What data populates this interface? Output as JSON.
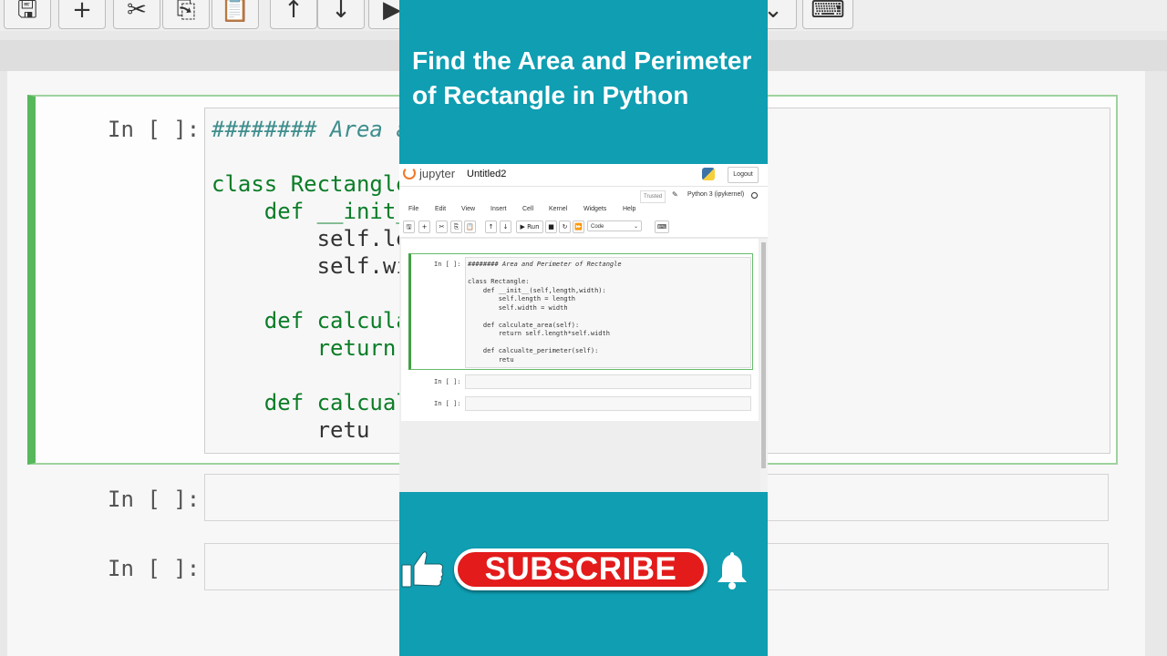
{
  "headline": "Find the Area and Perimeter of Rectangle in Python",
  "background": {
    "prompts": [
      "In [ ]:",
      "In [ ]:",
      "In [ ]:"
    ],
    "code_lines": [
      {
        "t": "######## Area a",
        "cls": "c"
      },
      {
        "t": "class Rectangle",
        "cls": ""
      },
      {
        "t": "    def __init_",
        "cls": ""
      },
      {
        "t": "        self.le",
        "cls": ""
      },
      {
        "t": "        self.wi",
        "cls": ""
      },
      {
        "t": "    def calcula",
        "cls": ""
      },
      {
        "t": "        return ",
        "cls": ""
      },
      {
        "t": "    def calcual",
        "cls": ""
      },
      {
        "t": "        retu",
        "cls": ""
      }
    ]
  },
  "jupyter": {
    "logo_text": "jupyter",
    "notebook_title": "Untitled2",
    "logout_label": "Logout",
    "trusted_label": "Trusted",
    "kernel_label": "Python 3 (ipykernel)",
    "menu": [
      "File",
      "Edit",
      "View",
      "Insert",
      "Cell",
      "Kernel",
      "Widgets",
      "Help"
    ],
    "toolbar": {
      "save": "🖫",
      "add": "+",
      "cut": "✂",
      "copy": "⎘",
      "paste": "📋",
      "up": "↑",
      "down": "↓",
      "run": "▶ Run",
      "stop": "■",
      "restart": "↻",
      "ff": "⏩",
      "keyboard": "⌨"
    },
    "cell_type": "Code",
    "prompts": [
      "In [ ]:",
      "In [ ]:",
      "In [ ]:"
    ],
    "code": [
      "######## Area and Perimeter of Rectangle",
      "",
      "class Rectangle:",
      "    def __init__(self,length,width):",
      "        self.length = length",
      "        self.width = width",
      "",
      "    def calculate_area(self):",
      "        return self.length*self.width",
      "",
      "    def calcualte_perimeter(self):",
      "        retu"
    ]
  },
  "subscribe_label": "SUBSCRIBE",
  "colors": {
    "teal_panel": "#0f9eb2",
    "subscribe_red": "#e31b1b",
    "cell_green": "#42a045"
  },
  "icons": [
    "thumbs-up-icon",
    "bell-icon",
    "python-icon",
    "jupyter-logo-icon"
  ]
}
